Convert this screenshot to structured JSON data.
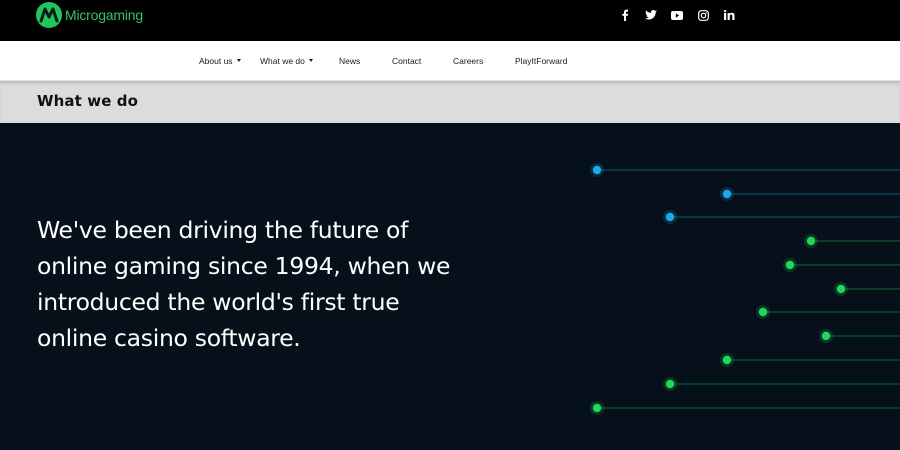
{
  "brand": {
    "name": "Microgaming",
    "accent": "#36c26a"
  },
  "socials": [
    {
      "icon": "facebook-icon"
    },
    {
      "icon": "twitter-icon"
    },
    {
      "icon": "youtube-icon"
    },
    {
      "icon": "instagram-icon"
    },
    {
      "icon": "linkedin-icon"
    }
  ],
  "nav": {
    "items": [
      {
        "label": "About us",
        "dropdown": true
      },
      {
        "label": "What we do",
        "dropdown": true
      },
      {
        "label": "News",
        "dropdown": false
      },
      {
        "label": "Contact",
        "dropdown": false
      },
      {
        "label": "Careers",
        "dropdown": false
      },
      {
        "label": "PlayItForward",
        "dropdown": false
      }
    ]
  },
  "page": {
    "title": "What we do"
  },
  "hero": {
    "lines": [
      "We've been driving the future of",
      "online gaming since 1994, when we",
      "introduced the world's first true",
      "online casino software."
    ]
  },
  "decor": {
    "colors": {
      "blue": "#1ea7e6",
      "green": "#22d65a",
      "background": "#05101a"
    }
  }
}
